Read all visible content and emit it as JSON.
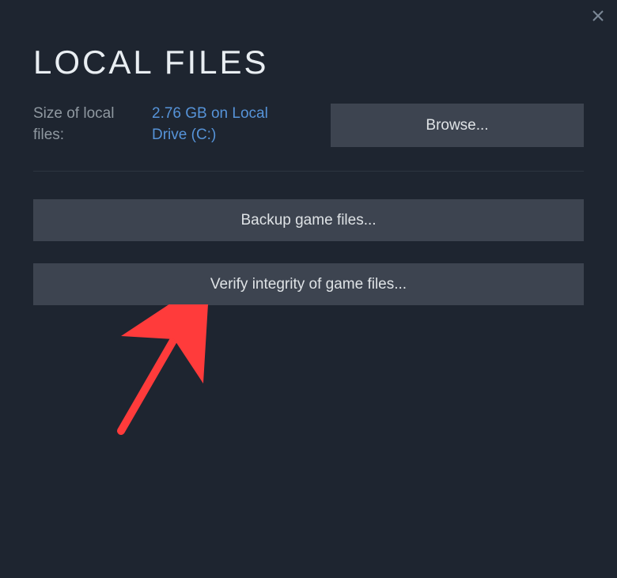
{
  "title": "LOCAL FILES",
  "size_info": {
    "label": "Size of local files:",
    "value": "2.76 GB on Local Drive (C:)"
  },
  "buttons": {
    "browse": "Browse...",
    "backup": "Backup game files...",
    "verify": "Verify integrity of game files..."
  }
}
